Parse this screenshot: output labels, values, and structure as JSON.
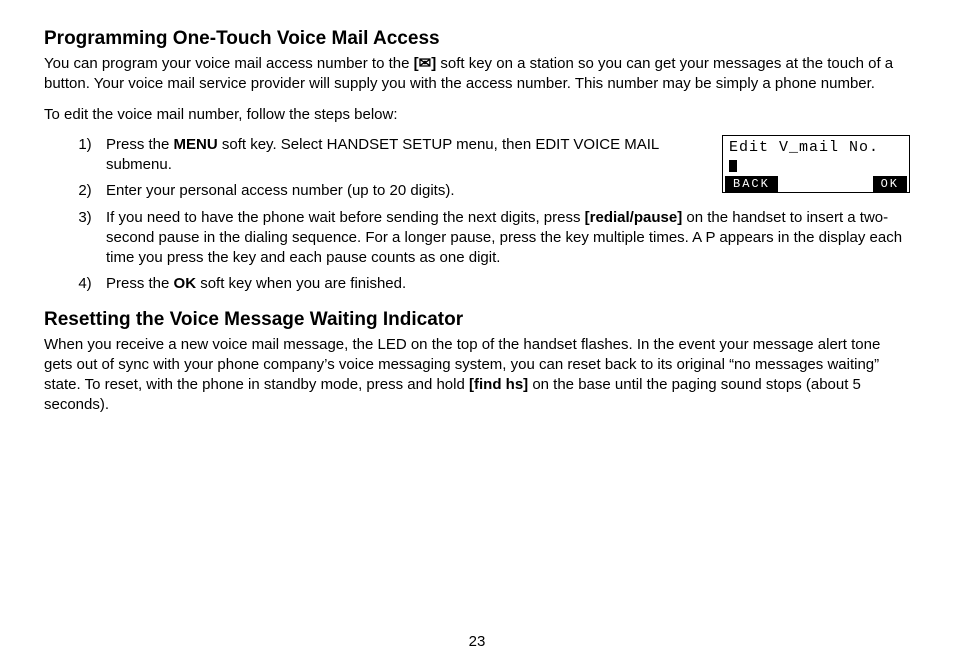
{
  "section1": {
    "heading": "Programming One-Touch Voice Mail Access",
    "intro_pre": "You can program your voice mail access number to the ",
    "intro_key": "[✉]",
    "intro_post": " soft key on a station so you can get your messages at the touch of a button. Your voice mail service provider will supply you with the access number. This number may be simply a phone number.",
    "lead": "To edit the voice mail number, follow the steps below:",
    "steps": {
      "s1_pre": "Press the ",
      "s1_b": "MENU",
      "s1_post": " soft key. Select HANDSET SETUP menu, then EDIT VOICE MAIL submenu.",
      "s2": "Enter your personal access number (up to 20 digits).",
      "s3_pre": "If you need to have the phone wait before sending the next digits, press ",
      "s3_b": "[redial/pause]",
      "s3_post": " on the handset to insert a two-second pause in the dialing sequence. For a longer pause, press the key multiple times. A P appears in the display each time you press the key and each pause counts as one digit.",
      "s4_pre": "Press the ",
      "s4_b": "OK",
      "s4_post": " soft key when you are finished."
    }
  },
  "lcd": {
    "title": "Edit V_mail No.",
    "btn_left": "BACK",
    "btn_right": "OK"
  },
  "section2": {
    "heading": "Resetting the Voice Message Waiting Indicator",
    "body_pre": "When you receive a new voice mail message, the LED on the top of the handset flashes. In the event your message alert tone gets out of sync with your phone company’s voice messaging system, you can reset back to its original “no messages waiting” state. To reset, with the phone in standby mode, press and hold ",
    "body_b": "[find hs]",
    "body_post": " on the base until the paging sound stops (about 5 seconds)."
  },
  "page_number": "23"
}
